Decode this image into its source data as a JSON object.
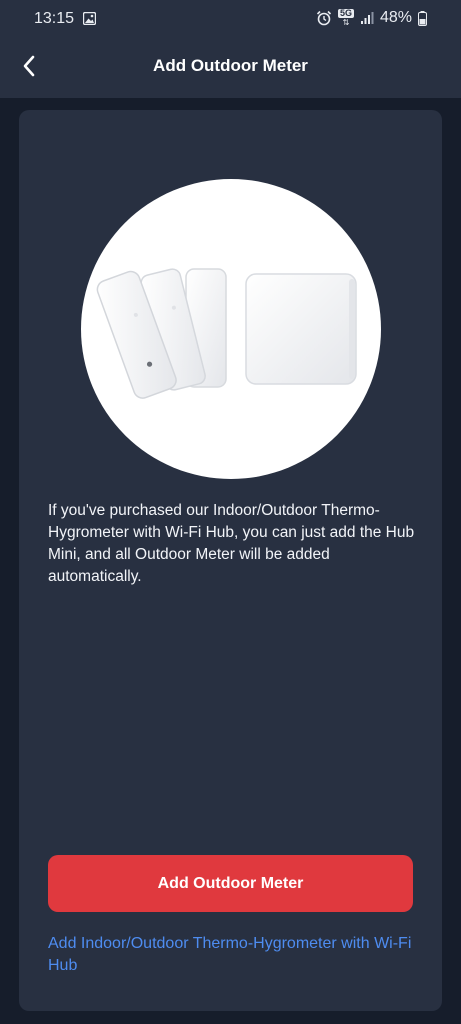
{
  "status_bar": {
    "time": "13:15",
    "battery": "48%",
    "network_badge": "5G",
    "icons": [
      "photo-icon",
      "alarm-icon",
      "5g-icon",
      "signal-icon",
      "battery-icon"
    ]
  },
  "app_bar": {
    "title": "Add Outdoor Meter",
    "back_icon": "chevron-left-icon"
  },
  "content": {
    "image_icon": "product-image",
    "description": "If you've purchased our Indoor/Outdoor Thermo-Hygrometer with Wi-Fi Hub, you can just add the Hub Mini, and all Outdoor Meter will be added automatically.",
    "primary_button": "Add Outdoor Meter",
    "secondary_link": "Add Indoor/Outdoor Thermo-Hygrometer with Wi-Fi Hub"
  },
  "colors": {
    "background": "#161d2b",
    "surface": "#283041",
    "accent_red": "#e0393e",
    "link_blue": "#4e8cf0",
    "text": "#ffffff"
  }
}
